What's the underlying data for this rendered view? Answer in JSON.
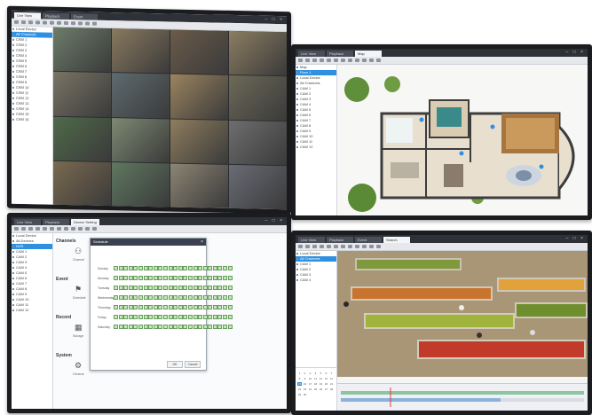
{
  "monitors": {
    "live_view": {
      "tabs": [
        "Live View",
        "Playback",
        "Event"
      ],
      "active_tab": 0,
      "tree": [
        "Local Device",
        "All Channels",
        "CAM 1",
        "CAM 2",
        "CAM 3",
        "CAM 4",
        "CAM 5",
        "CAM 6",
        "CAM 7",
        "CAM 8",
        "CAM 9",
        "CAM 10",
        "CAM 11",
        "CAM 12",
        "CAM 13",
        "CAM 14",
        "CAM 15",
        "CAM 16"
      ],
      "selected_tree_index": 1,
      "cameras": [
        "#6e7d6a",
        "#8a7a5f",
        "#6b5b4a",
        "#8c7d62",
        "#7a7465",
        "#5e6b6f",
        "#9b8460",
        "#6d6a58",
        "#4f6b4a",
        "#7d8a73",
        "#8f7d5e",
        "#6e6e6e",
        "#7b6a50",
        "#5f7860",
        "#8d8574",
        "#6a6c75"
      ]
    },
    "map_view": {
      "tabs": [
        "Live View",
        "Playback",
        "Map"
      ],
      "active_tab": 2,
      "tree": [
        "Map",
        "Floor 1",
        "Local Device",
        "All Channels",
        "CAM 1",
        "CAM 2",
        "CAM 3",
        "CAM 4",
        "CAM 5",
        "CAM 6",
        "CAM 7",
        "CAM 8",
        "CAM 9",
        "CAM 10",
        "CAM 11",
        "CAM 12"
      ],
      "selected_tree_index": 1
    },
    "settings_view": {
      "tabs": [
        "Live View",
        "Playback",
        "Device Setting"
      ],
      "active_tab": 2,
      "tree": [
        "Local Device",
        "All Devices",
        "NVR",
        "CAM 1",
        "CAM 2",
        "CAM 3",
        "CAM 4",
        "CAM 5",
        "CAM 6",
        "CAM 7",
        "CAM 8",
        "CAM 9",
        "CAM 10",
        "CAM 11",
        "CAM 12"
      ],
      "selected_tree_index": 2,
      "categories": [
        {
          "title": "Channels",
          "sub": "Channel",
          "icon": "⚇"
        },
        {
          "title": "Event",
          "sub": "Schedule",
          "icon": "⚑"
        },
        {
          "title": "Record",
          "sub": "Storage",
          "icon": "▦"
        },
        {
          "title": "System",
          "sub": "General",
          "icon": "⚙"
        }
      ],
      "dialog": {
        "title": "Schedule",
        "days": [
          "Sunday",
          "Monday",
          "Tuesday",
          "Wednesday",
          "Thursday",
          "Friday",
          "Saturday"
        ],
        "ok": "OK",
        "cancel": "Cancel"
      }
    },
    "playback_view": {
      "tabs": [
        "Live View",
        "Playback",
        "Event",
        "Search"
      ],
      "active_tab": 3,
      "tree": [
        "Local Device",
        "All Channels",
        "CAM 1",
        "CAM 2",
        "CAM 3",
        "CAM 4"
      ],
      "selected_tree_index": 1,
      "calendar_days": [
        "1",
        "2",
        "3",
        "4",
        "5",
        "6",
        "7",
        "8",
        "9",
        "10",
        "11",
        "12",
        "13",
        "14",
        "15",
        "16",
        "17",
        "18",
        "19",
        "20",
        "21",
        "22",
        "23",
        "24",
        "25",
        "26",
        "27",
        "28",
        "29",
        "30"
      ],
      "calendar_selected": 14
    }
  }
}
